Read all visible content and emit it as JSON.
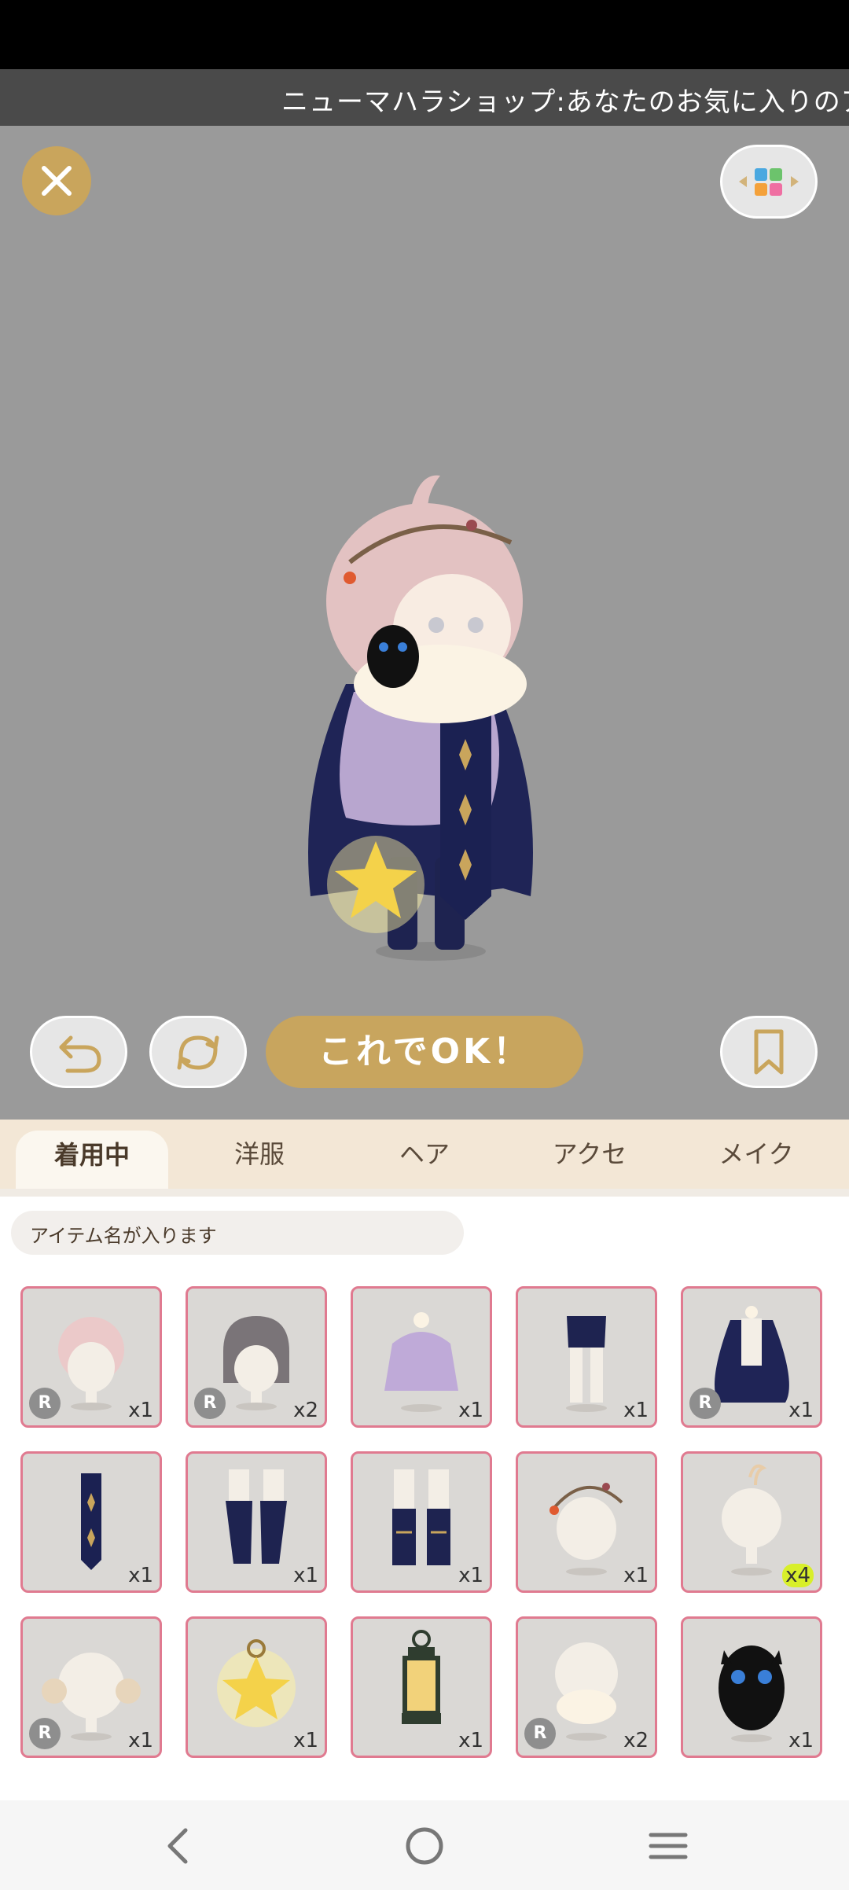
{
  "marquee": {
    "text": "ニューマハラショップ:あなたのお気に入りのア"
  },
  "actions": {
    "ok_label": "これでOK！"
  },
  "tabs": [
    {
      "label": "着用中"
    },
    {
      "label": "洋服"
    },
    {
      "label": "ヘア"
    },
    {
      "label": "アクセ"
    },
    {
      "label": "メイク"
    }
  ],
  "search": {
    "placeholder": "アイテム名が入ります"
  },
  "items": [
    {
      "name": "pink-curly-hair",
      "count": "x1",
      "rare": "R"
    },
    {
      "name": "gray-bob-hair",
      "count": "x2",
      "rare": "R"
    },
    {
      "name": "lavender-cape-top",
      "count": "x1",
      "rare": ""
    },
    {
      "name": "navy-shorts-tights",
      "count": "x1",
      "rare": ""
    },
    {
      "name": "navy-cloak",
      "count": "x1",
      "rare": "R"
    },
    {
      "name": "star-stole",
      "count": "x1",
      "rare": ""
    },
    {
      "name": "navy-boots",
      "count": "x1",
      "rare": ""
    },
    {
      "name": "navy-ribbon-boots",
      "count": "x1",
      "rare": ""
    },
    {
      "name": "berry-vine-crown",
      "count": "x1",
      "rare": ""
    },
    {
      "name": "ahoge-hair-part",
      "count": "x4",
      "rare": ""
    },
    {
      "name": "bear-ear-hair-part",
      "count": "x1",
      "rare": "R"
    },
    {
      "name": "star-lantern",
      "count": "x1",
      "rare": ""
    },
    {
      "name": "green-lantern",
      "count": "x1",
      "rare": ""
    },
    {
      "name": "cream-muffler",
      "count": "x2",
      "rare": "R"
    },
    {
      "name": "black-owl",
      "count": "x1",
      "rare": ""
    }
  ],
  "colors": {
    "accent": "#c8a55e",
    "tab_bg": "#f3e7d6",
    "item_border": "#e07a90",
    "stage_bg": "#9a9a9a"
  }
}
